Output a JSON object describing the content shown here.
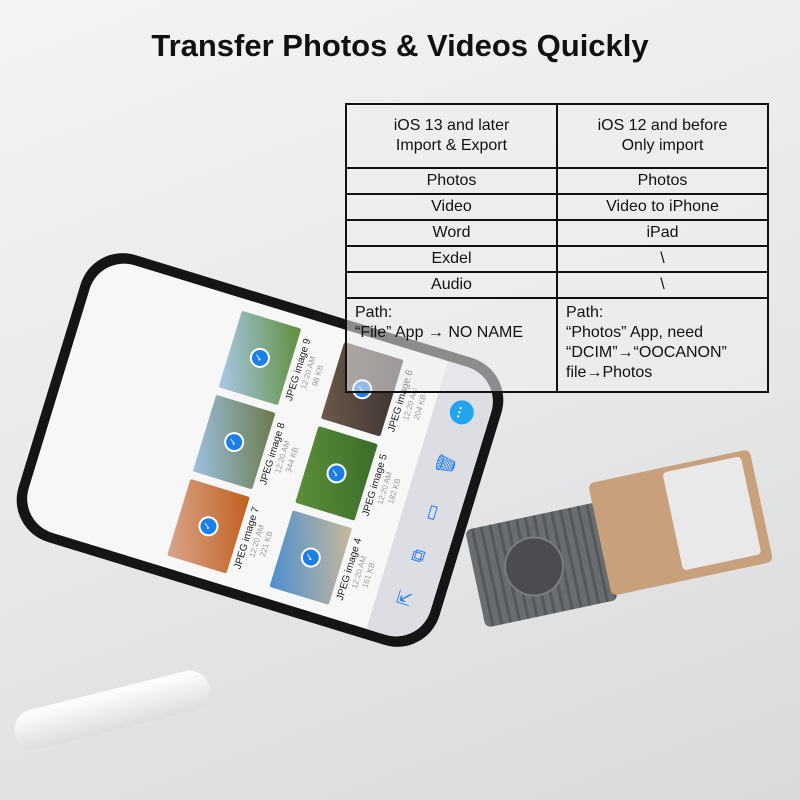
{
  "title": "Transfer Photos & Videos Quickly",
  "table": {
    "headers": [
      [
        "iOS 13 and later",
        "Import & Export"
      ],
      [
        "iOS 12 and before",
        "Only import"
      ]
    ],
    "rows": [
      [
        "Photos",
        "Photos"
      ],
      [
        "Video",
        "Video to iPhone"
      ],
      [
        "Word",
        "iPad"
      ],
      [
        "Exdel",
        "\\"
      ],
      [
        "Audio",
        "\\"
      ]
    ],
    "path_left": [
      "Path:",
      "“File” App → NO NAME"
    ],
    "path_right": [
      "Path:",
      "“Photos” App, need",
      "“DCIM”→“OOCANON”",
      "file→Photos"
    ]
  },
  "phone": {
    "files": [
      {
        "name": "JPEG image 4",
        "time": "12:20 AM",
        "size": "161 KB",
        "colors": [
          "#4a8fd0",
          "#c9b89a"
        ]
      },
      {
        "name": "JPEG image 5",
        "time": "12:20 AM",
        "size": "182 KB",
        "colors": [
          "#5b8f3a",
          "#3c6d2a"
        ]
      },
      {
        "name": "JPEG image 6",
        "time": "12:20 AM",
        "size": "204 KB",
        "colors": [
          "#6b5a4a",
          "#3b3030"
        ]
      },
      {
        "name": "JPEG image 7",
        "time": "12:20 AM",
        "size": "221 KB",
        "colors": [
          "#d9a58a",
          "#c0601e"
        ]
      },
      {
        "name": "JPEG image 8",
        "time": "12:20 AM",
        "size": "344 KB",
        "colors": [
          "#9dc0e0",
          "#6b7a4a"
        ]
      },
      {
        "name": "JPEG image 9",
        "time": "12:20 AM",
        "size": "98 KB",
        "colors": [
          "#a9c8e8",
          "#5f8f3a"
        ]
      }
    ],
    "toolbar_icons": [
      "share-icon",
      "duplicate-icon",
      "folder-icon",
      "trash-icon",
      "more-icon"
    ],
    "accent": "#2b7de9"
  }
}
